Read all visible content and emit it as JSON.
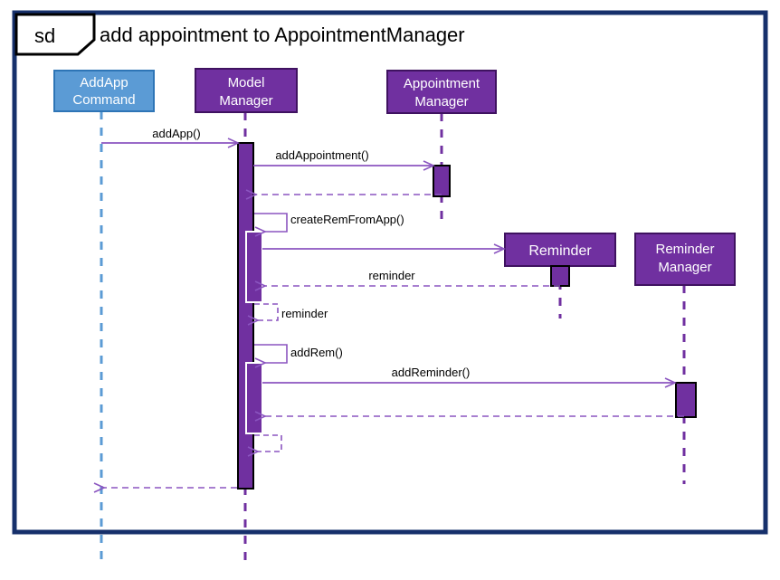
{
  "diagram": {
    "kind": "uml-sequence-diagram",
    "frame_label": "sd",
    "title": "add appointment to AppointmentManager",
    "colors": {
      "frame_border": "#16306B",
      "actor_purple_fill": "#7030A0",
      "actor_purple_border": "#3F1260",
      "actor_blue_fill": "#5B9BD5",
      "actor_blue_border": "#2E75B6",
      "lifeline_purple": "#7030A0",
      "lifeline_blue": "#5B9BD5",
      "message_line": "#8B55C0",
      "activation_fill": "#7030A0",
      "activation_border": "#000000",
      "text_dark": "#000000",
      "text_light": "#FFFFFF"
    }
  },
  "participants": [
    {
      "id": "addapp",
      "label_line1": "AddApp",
      "label_line2": "Command",
      "style": "blue"
    },
    {
      "id": "model",
      "label_line1": "Model",
      "label_line2": "Manager",
      "style": "purple"
    },
    {
      "id": "appt",
      "label_line1": "Appointment",
      "label_line2": "Manager",
      "style": "purple"
    },
    {
      "id": "reminder",
      "label_line1": "Reminder",
      "label_line2": "",
      "style": "purple"
    },
    {
      "id": "remmgr",
      "label_line1": "Reminder",
      "label_line2": "Manager",
      "style": "purple"
    }
  ],
  "messages": [
    {
      "id": "m1",
      "label": "addApp()",
      "from": "addapp",
      "to": "model",
      "kind": "call",
      "style": "solid"
    },
    {
      "id": "m2",
      "label": "addAppointment()",
      "from": "model",
      "to": "appt",
      "kind": "call",
      "style": "solid"
    },
    {
      "id": "m3",
      "label": "",
      "from": "appt",
      "to": "model",
      "kind": "return",
      "style": "dashed"
    },
    {
      "id": "m4",
      "label": "createRemFromApp()",
      "from": "model",
      "to": "model",
      "kind": "self",
      "style": "solid"
    },
    {
      "id": "m5",
      "label": "",
      "from": "model",
      "to": "reminder",
      "kind": "create",
      "style": "solid"
    },
    {
      "id": "m6",
      "label": "reminder",
      "from": "reminder",
      "to": "model",
      "kind": "return",
      "style": "dashed"
    },
    {
      "id": "m7",
      "label": "reminder",
      "from": "model",
      "to": "model",
      "kind": "self",
      "style": "dashed"
    },
    {
      "id": "m8",
      "label": "addRem()",
      "from": "model",
      "to": "model",
      "kind": "self",
      "style": "solid"
    },
    {
      "id": "m9",
      "label": "addReminder()",
      "from": "model",
      "to": "remmgr",
      "kind": "call",
      "style": "solid"
    },
    {
      "id": "m10",
      "label": "",
      "from": "remmgr",
      "to": "model",
      "kind": "return",
      "style": "dashed"
    },
    {
      "id": "m11",
      "label": "",
      "from": "model",
      "to": "model",
      "kind": "self",
      "style": "dashed"
    },
    {
      "id": "m12",
      "label": "",
      "from": "model",
      "to": "addapp",
      "kind": "return",
      "style": "dashed"
    }
  ]
}
